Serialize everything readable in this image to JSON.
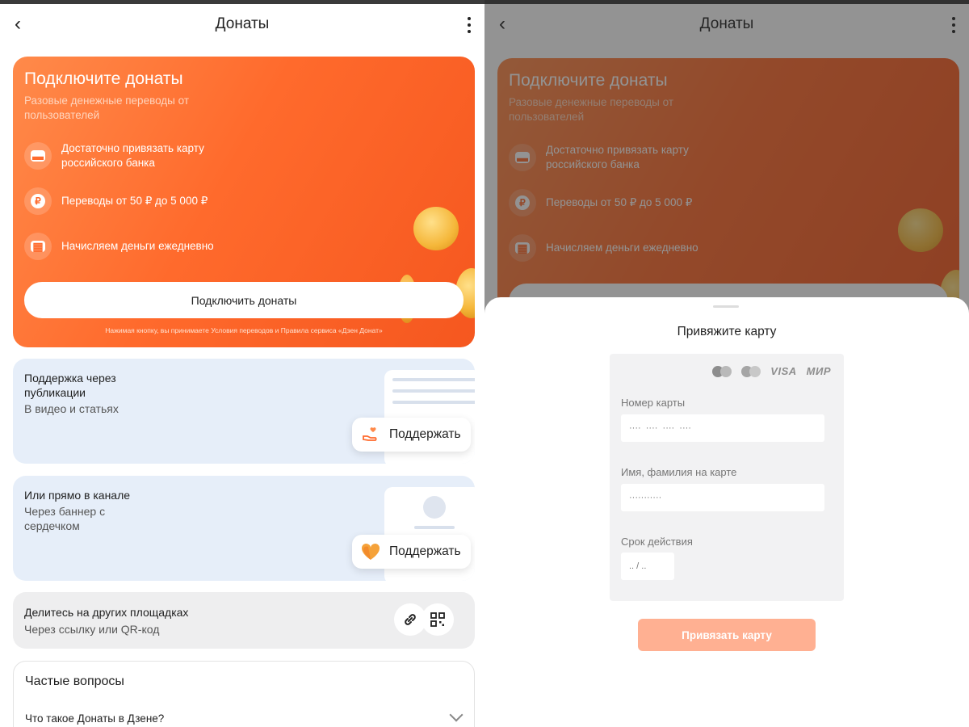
{
  "left": {
    "header": {
      "back_icon": "chevron-left-icon",
      "title": "Донаты",
      "more_icon": "more-vertical-icon"
    },
    "promo": {
      "title": "Подключите донаты",
      "subtitle": "Разовые денежные переводы от пользователей",
      "features": [
        {
          "icon": "card-icon",
          "text": "Достаточно привязать карту российского банка"
        },
        {
          "icon": "ruble-icon",
          "text": "Переводы от 50 ₽ до 5 000 ₽"
        },
        {
          "icon": "calendar-icon",
          "text": "Начисляем деньги ежедневно"
        }
      ],
      "button": "Подключить донаты",
      "terms": "Нажимая кнопку, вы принимаете Условия переводов и Правила сервиса «Дзен Донат»",
      "accent_color": "#ff6a2c"
    },
    "publications": {
      "title": "Поддержка через публикации",
      "subtitle": "В видео и статьях",
      "button": "Поддержать",
      "button_icon": "hand-heart-icon"
    },
    "channel": {
      "title": "Или прямо в канале",
      "subtitle": "Через баннер с сердечком",
      "button": "Поддержать",
      "button_icon": "heart-icon"
    },
    "share": {
      "title": "Делитесь на других площадках",
      "subtitle": "Через ссылку или QR-код",
      "link_icon": "link-icon",
      "qr_icon": "qr-code-icon"
    },
    "faq": {
      "title": "Частые вопросы",
      "question": "Что такое Донаты в Дзене?",
      "chevron_icon": "chevron-down-icon"
    }
  },
  "right": {
    "header": {
      "title": "Донаты"
    },
    "promo": {
      "title": "Подключите донаты",
      "subtitle": "Разовые денежные переводы от пользователей",
      "features": [
        {
          "text": "Достаточно привязать карту российского банка"
        },
        {
          "text": "Переводы от 50 ₽ до 5 000 ₽"
        },
        {
          "text": "Начисляем деньги ежедневно"
        }
      ]
    },
    "sheet": {
      "title": "Привяжите карту",
      "brands": {
        "visa": "VISA",
        "mir": "МИР"
      },
      "card_number": {
        "label": "Номер карты",
        "placeholder": "····  ····  ····  ····"
      },
      "card_name": {
        "label": "Имя, фамилия на карте",
        "placeholder": "···········"
      },
      "expiry": {
        "label": "Срок действия",
        "placeholder": ".. / .."
      },
      "button": "Привязать карту"
    }
  }
}
